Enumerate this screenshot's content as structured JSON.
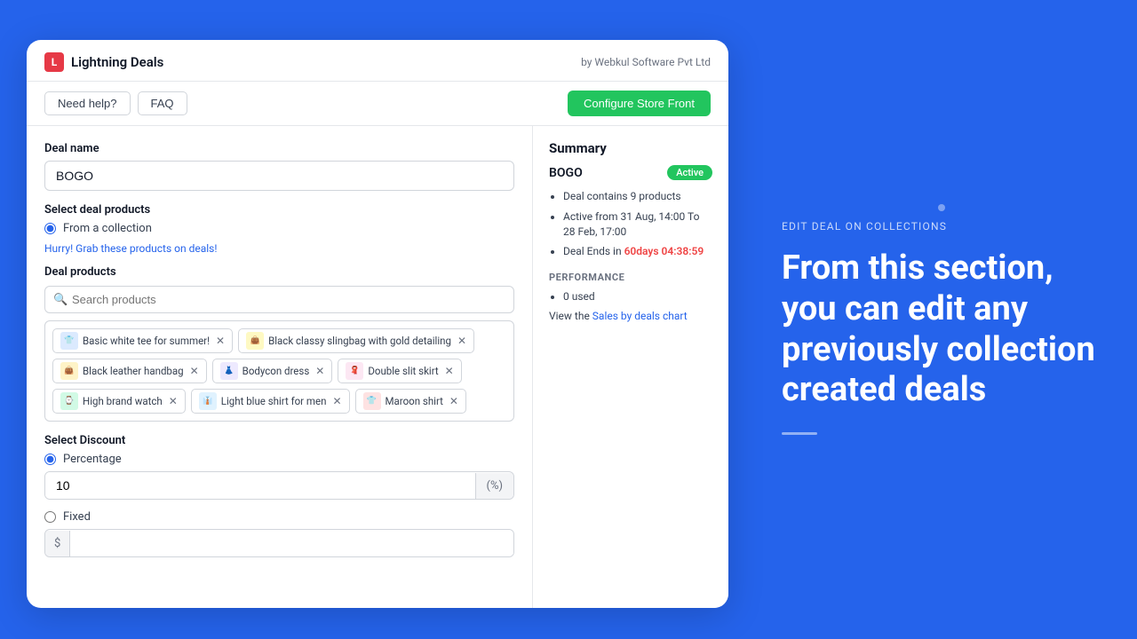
{
  "app": {
    "logo_text": "L",
    "title": "Lightning Deals",
    "by_label": "by Webkul Software Pvt Ltd"
  },
  "nav": {
    "need_help": "Need help?",
    "faq": "FAQ",
    "configure_btn": "Configure Store Front"
  },
  "form": {
    "deal_name_label": "Deal name",
    "deal_name_value": "BOGO",
    "select_deal_products_label": "Select deal products",
    "from_collection_label": "From a collection",
    "promo_text": "Hurry! Grab these products on deals!",
    "deal_products_label": "Deal products",
    "search_placeholder": "Search products",
    "tags": [
      {
        "id": "tag-tee",
        "label": "Basic white tee for summer!",
        "color": "tee"
      },
      {
        "id": "tag-slingbag",
        "label": "Black classy slingbag with gold detailing",
        "color": "slingbag"
      },
      {
        "id": "tag-leather",
        "label": "Black leather handbag",
        "color": "bag"
      },
      {
        "id": "tag-bodycon",
        "label": "Bodycon dress",
        "color": "bodycon"
      },
      {
        "id": "tag-slit",
        "label": "Double slit skirt",
        "color": "slit"
      },
      {
        "id": "tag-watch",
        "label": "High brand watch",
        "color": "watch"
      },
      {
        "id": "tag-blueshirt",
        "label": "Light blue shirt for men",
        "color": "blue-shirt"
      },
      {
        "id": "tag-maroon",
        "label": "Maroon shirt",
        "color": "maroon"
      }
    ],
    "select_discount_label": "Select Discount",
    "percentage_label": "Percentage",
    "percentage_value": "10",
    "pct_symbol": "(%)",
    "fixed_label": "Fixed",
    "dollar_symbol": "$",
    "fixed_value": ""
  },
  "summary": {
    "title": "Summary",
    "deal_name": "BOGO",
    "status": "Active",
    "bullet1": "Deal contains 9 products",
    "bullet2": "Active from 31 Aug, 14:00 To 28 Feb, 17:00",
    "deal_ends_prefix": "Deal Ends in ",
    "deal_ends_highlight": "60days 04:38:59",
    "performance_label": "PERFORMANCE",
    "perf_bullet1": "0 used",
    "view_chart_prefix": "View the ",
    "chart_link_text": "Sales by deals chart"
  },
  "right_side": {
    "subtitle": "EDIT DEAL ON COLLECTIONS",
    "headline": "From this section, you can edit any previously collection created deals"
  }
}
